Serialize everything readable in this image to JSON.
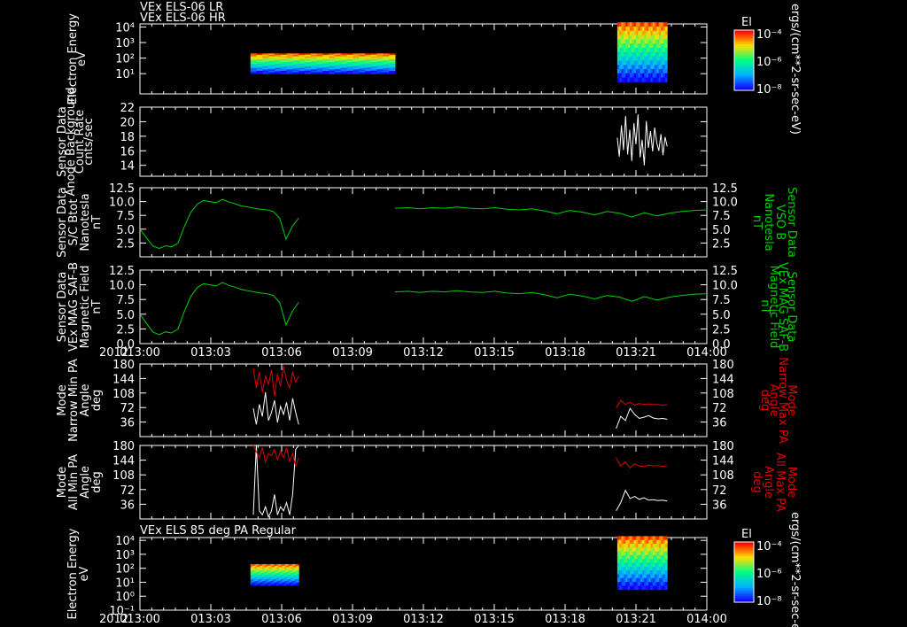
{
  "header": {
    "line1": "VEx ELS-06 LR",
    "line2": "VEx ELS-06 HR"
  },
  "colorbar_unit": "ergs/(cm**2-sr-sec-eV)",
  "colorbars": [
    {
      "title": "El",
      "labels": [
        "10⁻⁴",
        "10⁻⁶",
        "10⁻⁸"
      ]
    },
    {
      "title": "El",
      "labels": [
        "10⁻⁴",
        "10⁻⁶",
        "10⁻⁸"
      ]
    }
  ],
  "time_axis": {
    "year": "2012",
    "labels": [
      "013:00",
      "013:03",
      "013:06",
      "013:09",
      "013:12",
      "013:15",
      "013:18",
      "013:21",
      "014:00"
    ]
  },
  "chart_data": [
    {
      "type": "heatmap",
      "title": "VEx ELS-06 LR / VEx ELS-06 HR",
      "ylabel": [
        "Electron Energy",
        "eV"
      ],
      "yticks": [
        "10⁴",
        "10³",
        "10²",
        "10¹"
      ],
      "colorbar": "El",
      "blocks": [
        {
          "x_start": 0.195,
          "x_end": 0.45,
          "e_min": 10,
          "e_max": 200
        },
        {
          "x_start": 0.842,
          "x_end": 0.93,
          "e_min": 3,
          "e_max": 20000
        }
      ],
      "colors": [
        "#1200ff",
        "#00b4ff",
        "#00ff80",
        "#ffe000",
        "#ff0000"
      ]
    },
    {
      "type": "line",
      "ylabel": [
        "Sensor Data",
        "Anode Background",
        "Count Rate",
        "cnts/sec"
      ],
      "yticks": [
        "22",
        "20",
        "18",
        "16",
        "14"
      ],
      "ylim": [
        12.5,
        22
      ],
      "series": [
        {
          "color": "#ffffff",
          "x_start": 0.842,
          "x_end": 0.93,
          "values": [
            17.8,
            15.2,
            19.5,
            16.1,
            20.8,
            15.5,
            18.9,
            14.6,
            19.8,
            16.9,
            21.0,
            15.1,
            17.5,
            14.0,
            20.1,
            16.4,
            18.7,
            15.9,
            19.2,
            17.1,
            16.0,
            18.3,
            15.4,
            17.9,
            16.6
          ]
        }
      ]
    },
    {
      "type": "line",
      "ylabel": [
        "Sensor Data",
        "S/C Btot",
        "Nanotesla",
        "nT"
      ],
      "ylabel_right": [
        "Sensor Data",
        "VSO B",
        "Nanotesla",
        "nT"
      ],
      "yticks": [
        "12.5",
        "10.0",
        "7.5",
        "5.0",
        "2.5"
      ],
      "ylim": [
        0,
        12.5
      ],
      "series": [
        {
          "color": "#00d000",
          "segments": [
            {
              "x_start": 0.0,
              "x_end": 0.28,
              "values": [
                5.0,
                3.5,
                2.0,
                1.5,
                2.0,
                1.8,
                2.5,
                5.5,
                8.0,
                9.5,
                10.2,
                10.0,
                9.8,
                10.4,
                9.9,
                9.6,
                9.2,
                9.0,
                8.8,
                8.6,
                8.5,
                8.2,
                7.0,
                3.2,
                5.5,
                7.0
              ]
            },
            {
              "x_start": 0.45,
              "x_end": 1.0,
              "values": [
                8.8,
                8.9,
                8.7,
                8.9,
                8.8,
                9.0,
                8.8,
                8.7,
                8.9,
                8.6,
                8.5,
                8.7,
                8.3,
                7.8,
                8.4,
                8.1,
                7.6,
                8.2,
                7.9,
                7.2,
                8.0,
                7.4,
                7.9,
                8.2,
                8.4,
                8.5
              ]
            }
          ]
        }
      ]
    },
    {
      "type": "line",
      "ylabel": [
        "Sensor Data",
        "VEx MAG SAF-B",
        "Magnetic Field",
        "nT"
      ],
      "ylabel_right": [
        "Sensor Data",
        "VEx MAG SAF-B",
        "Magnetic Field",
        "nT"
      ],
      "yticks": [
        "12.5",
        "10.0",
        "7.5",
        "5.0",
        "2.5",
        "0.0"
      ],
      "ylim": [
        0,
        12.5
      ],
      "series": [
        {
          "color": "#00d000",
          "segments": [
            {
              "x_start": 0.0,
              "x_end": 0.28,
              "values": [
                5.0,
                3.5,
                2.0,
                1.5,
                2.0,
                1.8,
                2.5,
                5.5,
                8.0,
                9.5,
                10.2,
                10.0,
                9.8,
                10.4,
                9.9,
                9.6,
                9.2,
                9.0,
                8.8,
                8.6,
                8.5,
                8.2,
                7.0,
                3.2,
                5.5,
                7.0
              ]
            },
            {
              "x_start": 0.45,
              "x_end": 1.0,
              "values": [
                8.8,
                8.9,
                8.7,
                8.9,
                8.8,
                9.0,
                8.8,
                8.7,
                8.9,
                8.6,
                8.5,
                8.7,
                8.3,
                7.8,
                8.4,
                8.1,
                7.6,
                8.2,
                7.9,
                7.2,
                8.0,
                7.4,
                7.9,
                8.2,
                8.4,
                8.5
              ]
            }
          ]
        }
      ]
    },
    {
      "type": "line",
      "ylabel": [
        "Mode",
        "Narrow Min PA",
        "Angle",
        "deg"
      ],
      "ylabel_right": [
        "Mode",
        "Narrow Max PA",
        "Angle",
        "deg"
      ],
      "yticks": [
        "180",
        "144",
        "108",
        "72",
        "36"
      ],
      "ylim": [
        0,
        180
      ],
      "series": [
        {
          "color": "#ffffff",
          "segments": [
            {
              "x_start": 0.2,
              "x_end": 0.28,
              "values": [
                70,
                30,
                80,
                50,
                110,
                40,
                60,
                90,
                35,
                75,
                55,
                85,
                40,
                95,
                60,
                30
              ]
            },
            {
              "x_start": 0.84,
              "x_end": 0.93,
              "values": [
                20,
                50,
                40,
                70,
                55,
                45,
                48,
                52,
                46,
                44,
                45,
                43
              ]
            }
          ]
        },
        {
          "color": "#e00000",
          "segments": [
            {
              "x_start": 0.2,
              "x_end": 0.28,
              "values": [
                170,
                120,
                160,
                110,
                150,
                130,
                165,
                100,
                155,
                125,
                175,
                140,
                120,
                160,
                135,
                150
              ]
            },
            {
              "x_start": 0.84,
              "x_end": 0.93,
              "values": [
                70,
                90,
                80,
                85,
                78,
                82,
                80,
                81,
                79,
                80,
                78,
                79
              ]
            }
          ]
        }
      ]
    },
    {
      "type": "line",
      "ylabel": [
        "Mode",
        "All Min PA",
        "Angle",
        "deg"
      ],
      "ylabel_right": [
        "Mode",
        "All Max PA",
        "Angle",
        "deg"
      ],
      "yticks": [
        "180",
        "144",
        "108",
        "72",
        "36"
      ],
      "ylim": [
        0,
        180
      ],
      "series": [
        {
          "color": "#ffffff",
          "segments": [
            {
              "x_start": 0.2,
              "x_end": 0.28,
              "values": [
                10,
                180,
                20,
                10,
                30,
                5,
                20,
                60,
                10,
                30,
                20,
                40,
                10,
                60,
                170,
                180
              ]
            },
            {
              "x_start": 0.84,
              "x_end": 0.93,
              "values": [
                20,
                40,
                70,
                50,
                55,
                48,
                52,
                46,
                47,
                45,
                46,
                44
              ]
            }
          ]
        },
        {
          "color": "#e00000",
          "segments": [
            {
              "x_start": 0.2,
              "x_end": 0.28,
              "values": [
                180,
                165,
                150,
                175,
                140,
                160,
                155,
                170,
                145,
                165,
                150,
                175,
                140,
                160,
                130,
                150
              ]
            },
            {
              "x_start": 0.84,
              "x_end": 0.93,
              "values": [
                150,
                130,
                140,
                125,
                135,
                130,
                128,
                132,
                130,
                131,
                129,
                130
              ]
            }
          ]
        }
      ]
    },
    {
      "type": "heatmap",
      "title": "VEx ELS 85 deg PA Regular",
      "ylabel": [
        "Electron Energy",
        "eV"
      ],
      "yticks": [
        "10⁴",
        "10³",
        "10²",
        "10¹",
        "10⁰",
        "10⁻¹"
      ],
      "colorbar": "El",
      "blocks": [
        {
          "x_start": 0.195,
          "x_end": 0.28,
          "e_min": 6,
          "e_max": 200
        },
        {
          "x_start": 0.842,
          "x_end": 0.93,
          "e_min": 3,
          "e_max": 20000
        }
      ],
      "colors": [
        "#1200ff",
        "#00b4ff",
        "#00ff80",
        "#ffe000",
        "#ff0000"
      ]
    }
  ]
}
